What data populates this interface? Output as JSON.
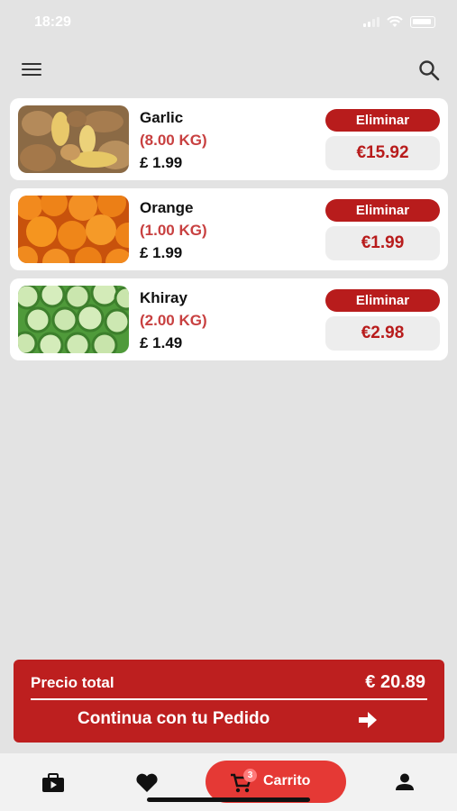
{
  "status": {
    "time": "18:29"
  },
  "cart": {
    "items": [
      {
        "name": "Garlic",
        "qty": "(8.00 KG)",
        "price": "£ 1.99",
        "remove_label": "Eliminar",
        "subtotal": "€15.92",
        "image": "ginger-photo"
      },
      {
        "name": "Orange",
        "qty": "(1.00 KG)",
        "price": "£ 1.99",
        "remove_label": "Eliminar",
        "subtotal": "€1.99",
        "image": "oranges-photo"
      },
      {
        "name": "Khiray",
        "qty": "(2.00 KG)",
        "price": "£ 1.49",
        "remove_label": "Eliminar",
        "subtotal": "€2.98",
        "image": "cucumber-photo"
      }
    ]
  },
  "checkout": {
    "total_label": "Precio total",
    "total_value": "€ 20.89",
    "continue_label": "Continua con tu Pedido"
  },
  "nav": {
    "cart_label": "Carrito",
    "cart_badge": "3"
  },
  "colors": {
    "accent": "#bd1f1f",
    "qty_text": "#c84040",
    "cart_pill": "#e53935",
    "background": "#e3e3e3"
  }
}
